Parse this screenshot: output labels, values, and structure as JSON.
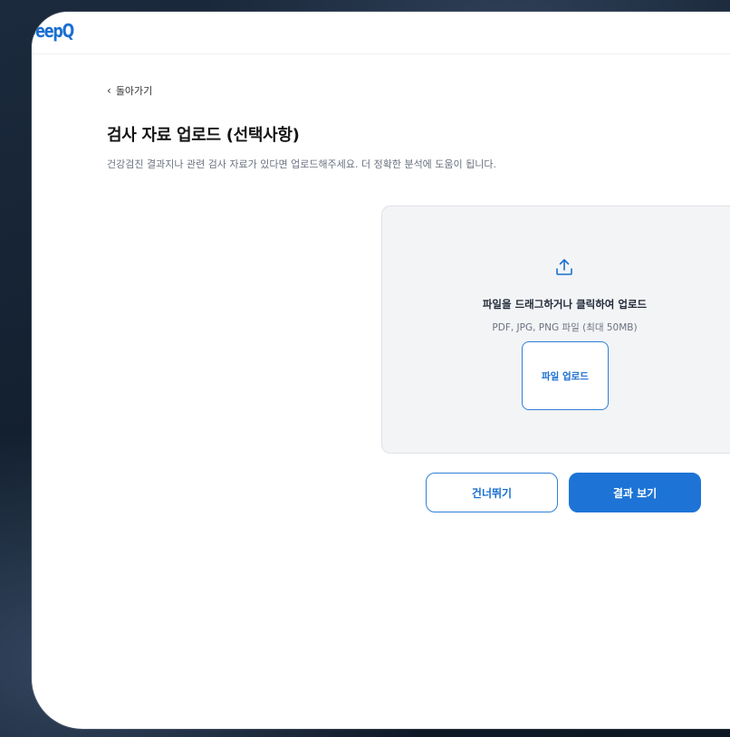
{
  "brand": {
    "logo_text": "DeepQ",
    "accent": "#1a6fd1"
  },
  "nav": {
    "back_label": "돌아가기"
  },
  "page": {
    "title": "검사 자료 업로드 (선택사항)",
    "subtitle": "건강검진 결과지나 관련 검사 자료가 있다면 업로드해주세요. 더 정확한 분석에 도움이 됩니다."
  },
  "dropzone": {
    "icon": "upload-icon",
    "title": "파일을 드래그하거나 클릭하여 업로드",
    "hint": "PDF, JPG, PNG 파일 (최대 50MB)",
    "button_label": "파일 업로드"
  },
  "actions": {
    "skip_label": "건너뛰기",
    "result_label": "결과 보기"
  }
}
